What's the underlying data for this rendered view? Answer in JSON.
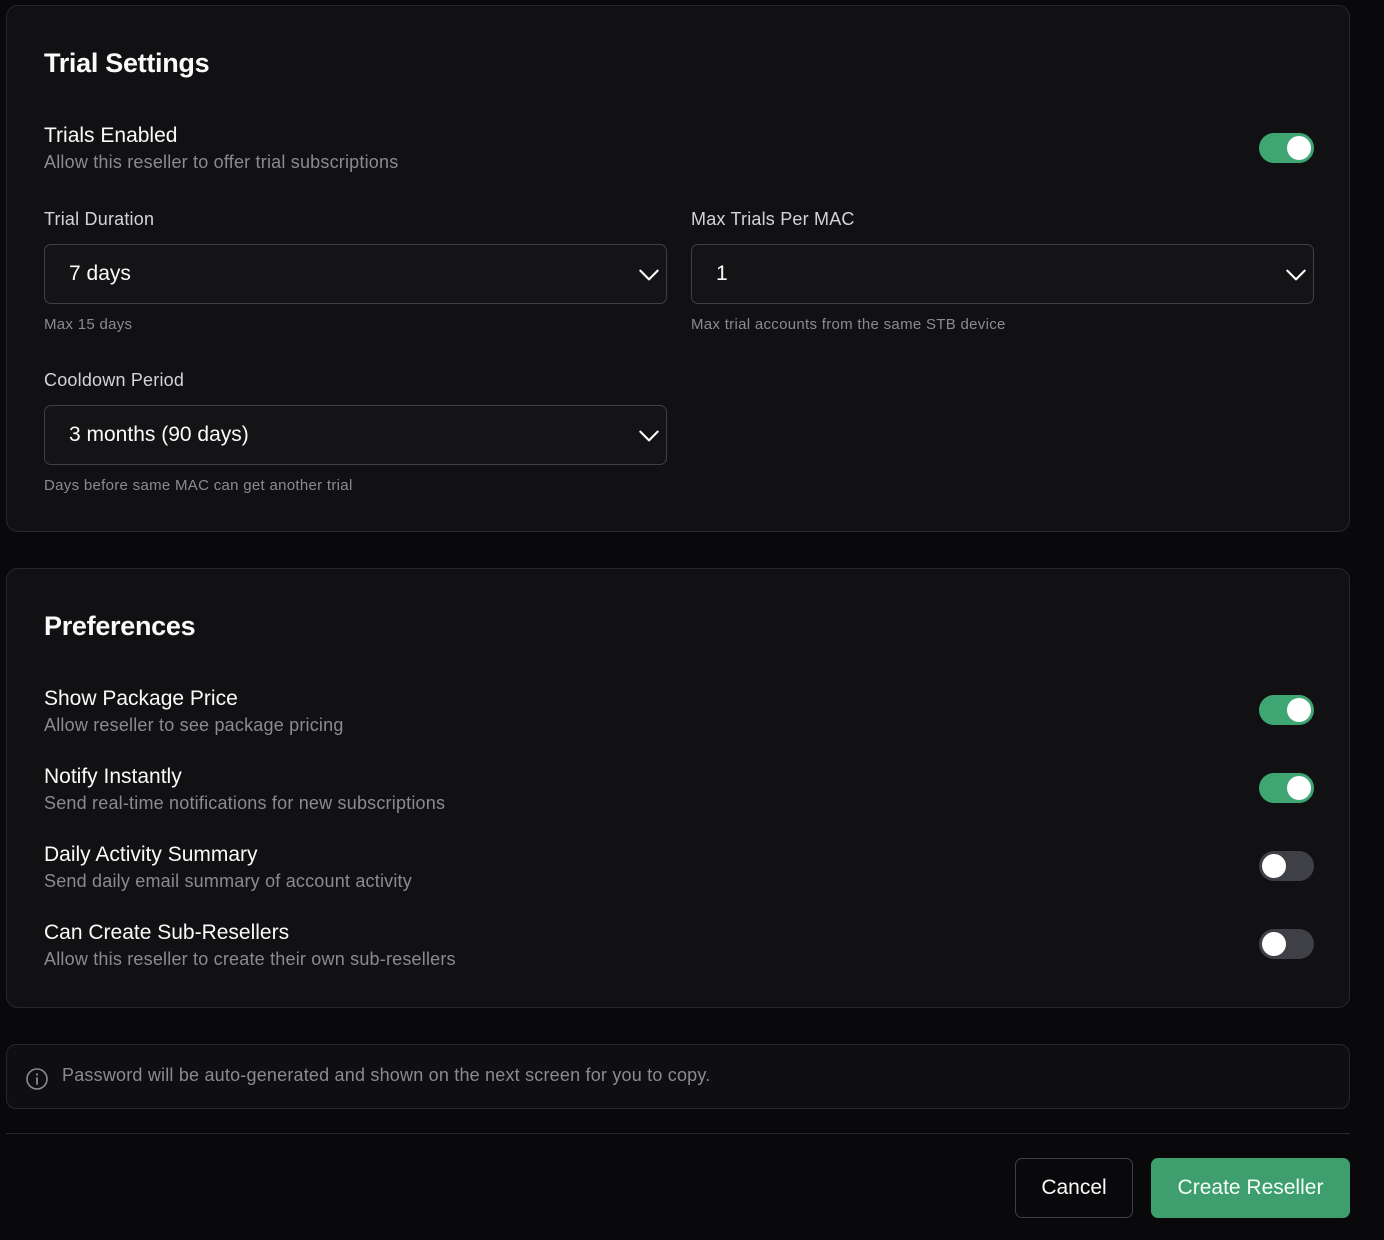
{
  "trial_settings": {
    "title": "Trial Settings",
    "trials_enabled": {
      "title": "Trials Enabled",
      "description": "Allow this reseller to offer trial subscriptions",
      "on": true
    },
    "trial_duration": {
      "label": "Trial Duration",
      "value": "7 days",
      "hint": "Max 15 days"
    },
    "max_trials_per_mac": {
      "label": "Max Trials Per MAC",
      "value": "1",
      "hint": "Max trial accounts from the same STB device"
    },
    "cooldown_period": {
      "label": "Cooldown Period",
      "value": "3 months (90 days)",
      "hint": "Days before same MAC can get another trial"
    }
  },
  "preferences": {
    "title": "Preferences",
    "items": [
      {
        "title": "Show Package Price",
        "description": "Allow reseller to see package pricing",
        "on": true
      },
      {
        "title": "Notify Instantly",
        "description": "Send real-time notifications for new subscriptions",
        "on": true
      },
      {
        "title": "Daily Activity Summary",
        "description": "Send daily email summary of account activity",
        "on": false
      },
      {
        "title": "Can Create Sub-Resellers",
        "description": "Allow this reseller to create their own sub-resellers",
        "on": false
      }
    ]
  },
  "info": {
    "icon": "info-icon",
    "text": "Password will be auto-generated and shown on the next screen for you to copy."
  },
  "footer": {
    "cancel_label": "Cancel",
    "create_label": "Create Reseller"
  },
  "colors": {
    "accent": "#3ea672",
    "background": "#09090b",
    "card": "#111113",
    "toggle_off": "#3f3f46"
  }
}
